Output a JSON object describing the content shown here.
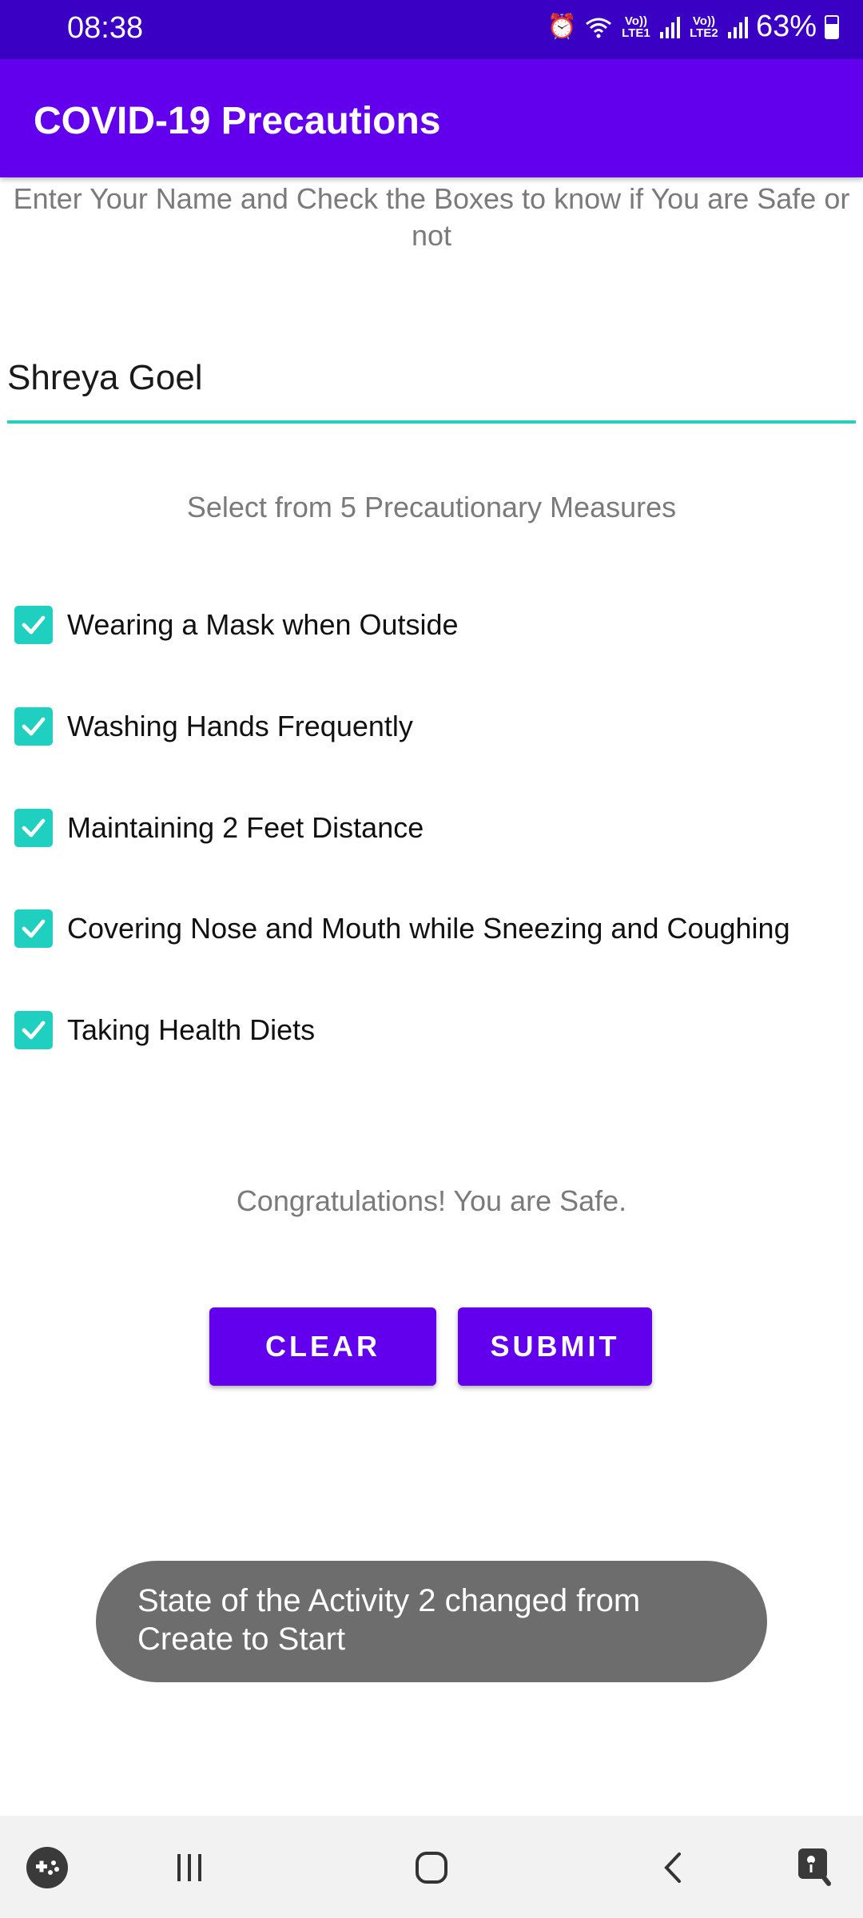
{
  "status_bar": {
    "time": "08:38",
    "sim1": "Vo)) LTE1",
    "sim2": "Vo)) LTE2",
    "battery": "63%"
  },
  "app_bar": {
    "title": "COVID-19 Precautions"
  },
  "main": {
    "instructions": "Enter Your Name and Check the Boxes to know if You are Safe or not",
    "name_value": "Shreya Goel",
    "subtitle": "Select from 5 Precautionary Measures",
    "precautions": [
      {
        "label": "Wearing a Mask when Outside",
        "checked": true
      },
      {
        "label": "Washing Hands Frequently",
        "checked": true
      },
      {
        "label": "Maintaining 2 Feet Distance",
        "checked": true
      },
      {
        "label": "Covering Nose and Mouth while Sneezing and Coughing",
        "checked": true
      },
      {
        "label": "Taking Health Diets",
        "checked": true
      }
    ],
    "result": "Congratulations! You are Safe.",
    "clear_label": "CLEAR",
    "submit_label": "SUBMIT"
  },
  "toast": {
    "message": "State of the Activity 2 changed from Create to Start"
  },
  "colors": {
    "status_bar": "#3a00c4",
    "app_bar": "#6200ee",
    "accent": "#1fcfbf",
    "toast": "#6d6d6d"
  },
  "nav_bar": {
    "icons": [
      "game-launcher-icon",
      "recent-apps-icon",
      "home-icon",
      "back-icon",
      "accessibility-icon"
    ]
  }
}
